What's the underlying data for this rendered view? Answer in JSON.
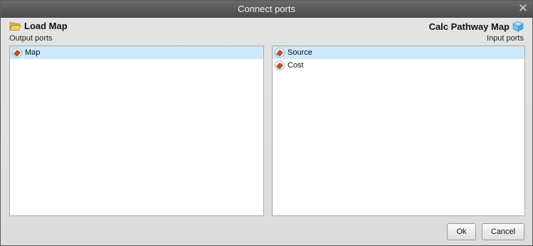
{
  "dialog": {
    "title": "Connect ports",
    "close_glyph": "✕"
  },
  "left": {
    "node_title": "Load Map",
    "node_icon": "folder-open-icon",
    "ports_label": "Output ports",
    "ports": [
      {
        "label": "Map",
        "icon": "map-layer-icon",
        "selected": true
      }
    ]
  },
  "right": {
    "node_title": "Calc Pathway Map",
    "node_icon": "cube-icon",
    "ports_label": "Input ports",
    "ports": [
      {
        "label": "Source",
        "icon": "map-layer-icon",
        "selected": true
      },
      {
        "label": "Cost",
        "icon": "map-layer-icon",
        "selected": false
      }
    ]
  },
  "buttons": {
    "ok": "Ok",
    "cancel": "Cancel"
  },
  "colors": {
    "titlebar": "#555555",
    "selection": "#cde8f8",
    "dialog_bg": "#e0e0e0"
  }
}
